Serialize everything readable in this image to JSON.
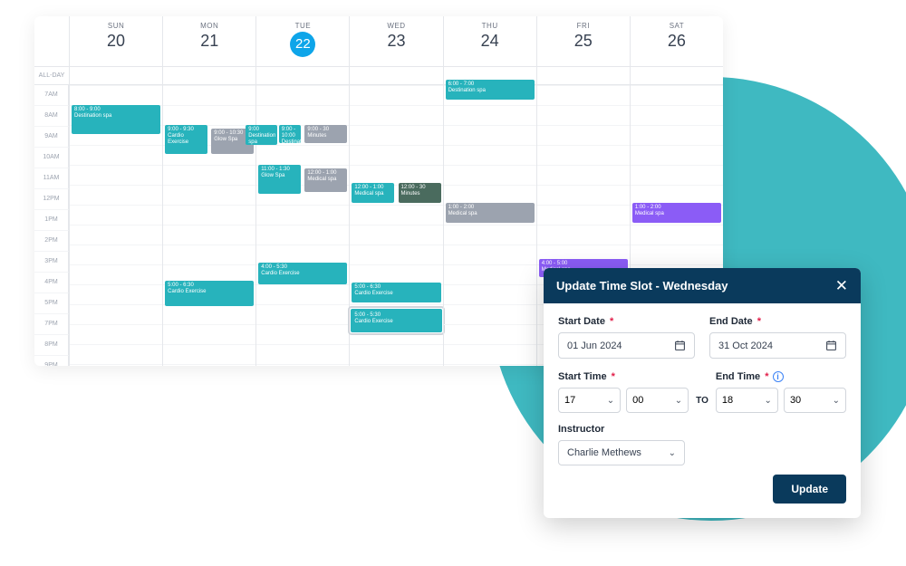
{
  "calendar": {
    "allday_label": "ALL-DAY",
    "days": [
      {
        "dow": "SUN",
        "num": "20",
        "today": false
      },
      {
        "dow": "MON",
        "num": "21",
        "today": false
      },
      {
        "dow": "TUE",
        "num": "22",
        "today": true
      },
      {
        "dow": "WED",
        "num": "23",
        "today": false
      },
      {
        "dow": "THU",
        "num": "24",
        "today": false
      },
      {
        "dow": "FRI",
        "num": "25",
        "today": false
      },
      {
        "dow": "SAT",
        "num": "26",
        "today": false
      }
    ],
    "time_labels": [
      "7AM",
      "8AM",
      "9AM",
      "10AM",
      "11AM",
      "12PM",
      "1PM",
      "2PM",
      "3PM",
      "4PM",
      "5PM",
      "7PM",
      "8PM",
      "9PM"
    ],
    "events": {
      "sun_8_dest": {
        "time": "8:00 - 9:00",
        "name": "Destination spa"
      },
      "mon_9_cardio": {
        "time": "9:00 - 9:30",
        "name": "Cardio Exercise"
      },
      "mon_9_glow": {
        "time": "9:00 - 10:30",
        "name": "Glow Spa"
      },
      "mon_5_cardio": {
        "time": "5:00 - 6:30",
        "name": "Cardio Exercise"
      },
      "tue_9_dest_s": {
        "time": "9:00",
        "name": "Destination spa"
      },
      "tue_9_dest": {
        "time": "9:00 - 10:00",
        "name": "Destination spa"
      },
      "tue_9_30min": {
        "time": "9:00 - 30 Minutes",
        "name": ""
      },
      "tue_11_glow": {
        "time": "11:00 - 1:30",
        "name": "Glow Spa"
      },
      "tue_11_med": {
        "time": "12:00 - 1:00",
        "name": "Medical spa"
      },
      "tue_4_cardio": {
        "time": "4:00 - 5:30",
        "name": "Cardio Exercise"
      },
      "wed_12_med": {
        "time": "12:00 - 1:00",
        "name": "Medical spa"
      },
      "wed_12_30min": {
        "time": "12:00 - 30 Minutes",
        "name": ""
      },
      "wed_5_cardio1": {
        "time": "5:00 - 6:30",
        "name": "Cardio Exercise"
      },
      "wed_5_cardio2": {
        "time": "5:00 - 5:30",
        "name": "Cardio Exercise"
      },
      "thu_6_dest": {
        "time": "6:00 - 7:00",
        "name": "Destination spa"
      },
      "thu_1_med": {
        "time": "1:00 - 2:00",
        "name": "Medical spa"
      },
      "fri_4_med": {
        "time": "4:00 - 5:00",
        "name": "Medical spa"
      },
      "sat_1_med": {
        "time": "1:00 - 2:00",
        "name": "Medical spa"
      }
    }
  },
  "modal": {
    "title": "Update Time Slot - Wednesday",
    "start_date_label": "Start Date",
    "end_date_label": "End Date",
    "start_date": "01 Jun 2024",
    "end_date": "31 Oct 2024",
    "start_time_label": "Start Time",
    "end_time_label": "End Time",
    "start_hour": "17",
    "start_min": "00",
    "end_hour": "18",
    "end_min": "30",
    "to_label": "TO",
    "instructor_label": "Instructor",
    "instructor": "Charlie Methews",
    "button": "Update"
  }
}
